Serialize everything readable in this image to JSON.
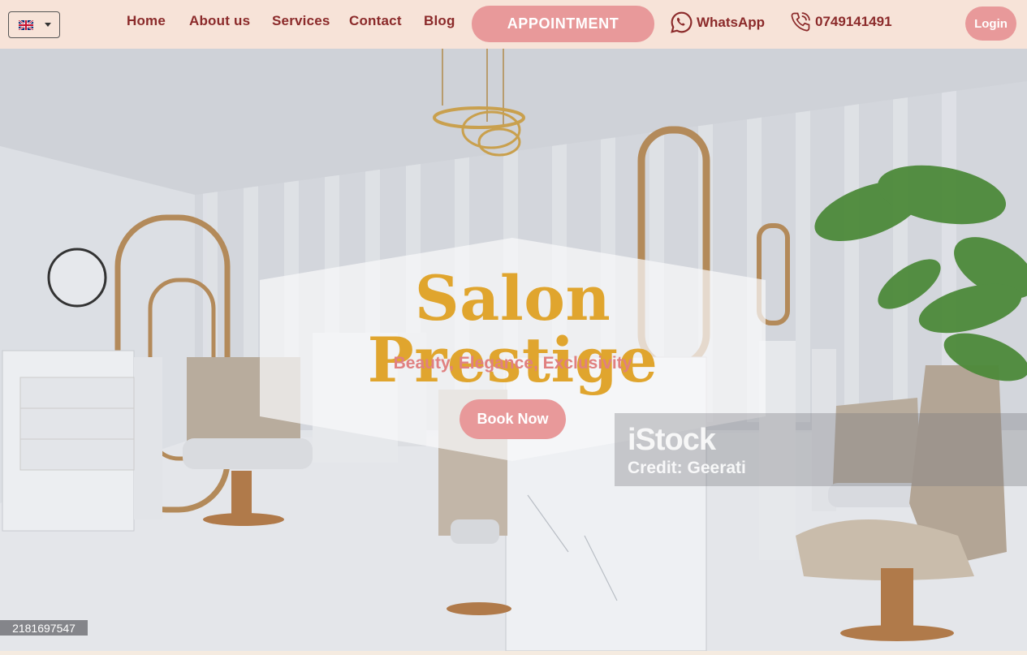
{
  "navbar": {
    "language": {
      "flag_icon": "uk-flag-icon",
      "selected": "en"
    },
    "links": [
      {
        "label": "Home"
      },
      {
        "label": "About us"
      },
      {
        "label": "Services"
      },
      {
        "label": "Contact"
      },
      {
        "label": "Blog"
      }
    ],
    "appointment_label": "APPOINTMENT",
    "whatsapp_label": "WhatsApp",
    "phone_label": "0749141491",
    "login_label": "Login"
  },
  "hero": {
    "title": "Salon Prestige",
    "subtitle": "Beauty, Elegance, Exclusivity",
    "cta_label": "Book Now",
    "watermark": {
      "logo": "iStock",
      "credit": "Credit: Geerati",
      "image_id": "2181697547"
    }
  },
  "colors": {
    "navbar_bg": "#f7e3d8",
    "link": "#8b2a2a",
    "button": "#e8999a",
    "title": "#e0a52e",
    "subtitle": "#e08080"
  }
}
